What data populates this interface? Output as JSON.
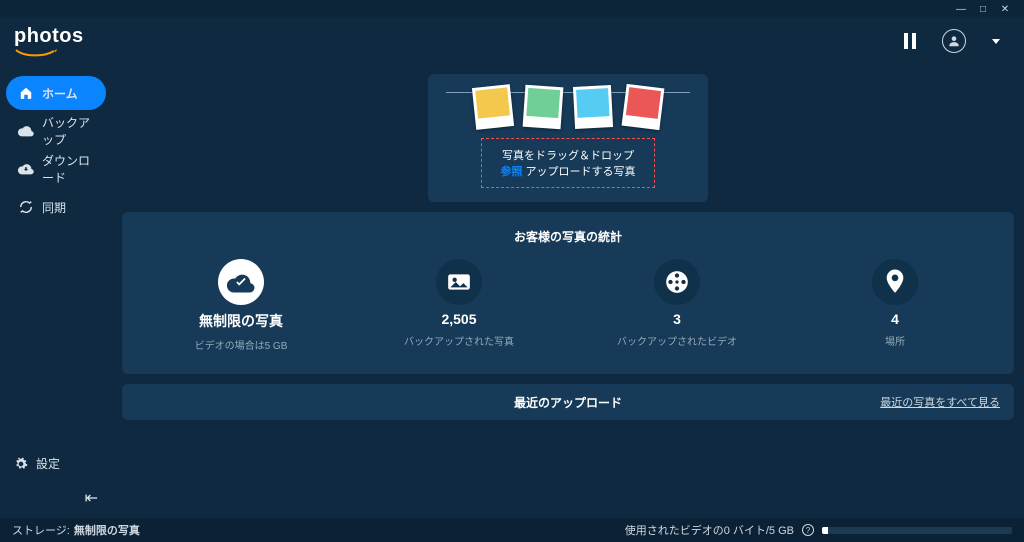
{
  "brand": "photos",
  "sidebar": {
    "items": [
      {
        "label": "ホーム",
        "icon": "home"
      },
      {
        "label": "バックアップ",
        "icon": "cloud"
      },
      {
        "label": "ダウンロード",
        "icon": "download"
      },
      {
        "label": "同期",
        "icon": "sync"
      }
    ],
    "settings_label": "設定"
  },
  "drop": {
    "line1": "写真をドラッグ＆ドロップ",
    "browse": "参照",
    "after": " アップロードする写真"
  },
  "stats": {
    "title": "お客様の写真の統計",
    "items": [
      {
        "big": "無制限の写真",
        "sub": "ビデオの場合は5 GB"
      },
      {
        "big": "2,505",
        "sub": "バックアップされた写真"
      },
      {
        "big": "3",
        "sub": "バックアップされたビデオ"
      },
      {
        "big": "4",
        "sub": "場所"
      }
    ]
  },
  "recent": {
    "title": "最近のアップロード",
    "link": "最近の写真をすべて見る"
  },
  "status": {
    "storage_label": "ストレージ:",
    "storage_value": "無制限の写真",
    "video_used": "使用されたビデオの0 バイト/5 GB"
  }
}
